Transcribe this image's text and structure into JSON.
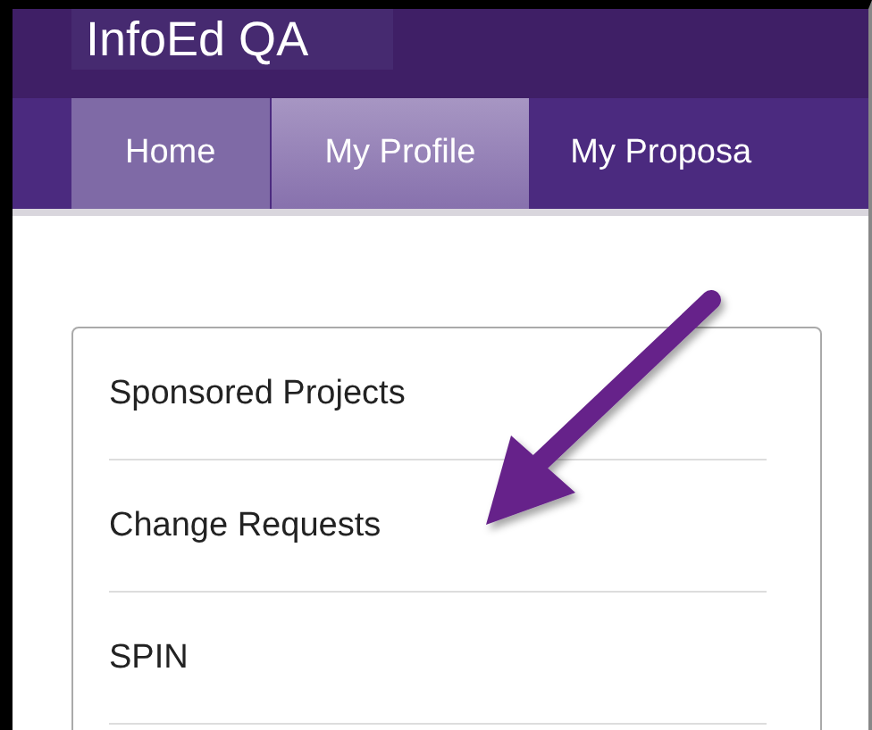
{
  "header": {
    "title": "InfoEd QA"
  },
  "nav": {
    "tabs": [
      {
        "label": "Home",
        "selected": false,
        "kind": "boxed"
      },
      {
        "label": "My Profile",
        "selected": true,
        "kind": "boxed"
      },
      {
        "label": "My Proposa",
        "selected": false,
        "kind": "plain"
      }
    ]
  },
  "menu": {
    "items": [
      {
        "label": "Sponsored Projects"
      },
      {
        "label": "Change Requests"
      },
      {
        "label": "SPIN"
      }
    ]
  }
}
